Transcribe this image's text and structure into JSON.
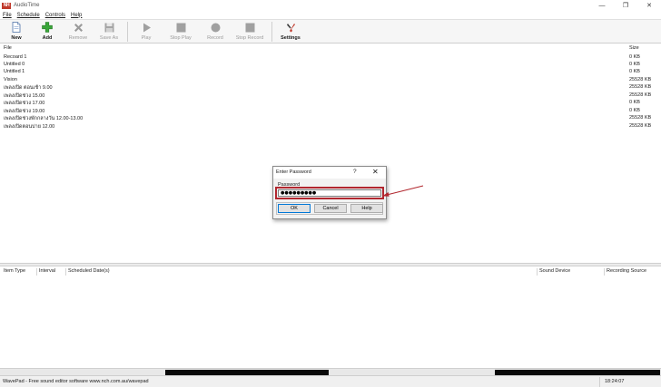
{
  "window": {
    "logo_text": "NH",
    "title": "AudioTime",
    "controls": [
      "—",
      "❐",
      "✕"
    ]
  },
  "menu": [
    "File",
    "Schedule",
    "Controls",
    "Help"
  ],
  "toolbar": {
    "buttons": [
      {
        "label": "New",
        "icon": "new-file-icon",
        "enabled": true
      },
      {
        "label": "Add",
        "icon": "add-plus-icon",
        "enabled": true
      },
      {
        "label": "Remove",
        "icon": "remove-x-icon",
        "enabled": false
      },
      {
        "label": "Save As",
        "icon": "save-disk-icon",
        "enabled": false
      },
      {
        "label": "Play",
        "icon": "play-icon",
        "enabled": false
      },
      {
        "label": "Stop Play",
        "icon": "stop-icon",
        "enabled": false
      },
      {
        "label": "Record",
        "icon": "record-icon",
        "enabled": false
      },
      {
        "label": "Stop Record",
        "icon": "stop-record-icon",
        "enabled": false
      },
      {
        "label": "Settings",
        "icon": "settings-tools-icon",
        "enabled": true
      }
    ]
  },
  "file_list": {
    "columns": {
      "file": "File",
      "size": "Size"
    },
    "rows": [
      {
        "name": "Recoard 1",
        "size": "0 KB"
      },
      {
        "name": "Untitled 0",
        "size": "0 KB"
      },
      {
        "name": "Untitled 1",
        "size": "0 KB"
      },
      {
        "name": "Vision",
        "size": "25528 KB"
      },
      {
        "name": "เพลงเปิด ตอนเช้า 9.00",
        "size": "25528 KB"
      },
      {
        "name": "เพลงเปิดช่วง 15.00",
        "size": "25528 KB"
      },
      {
        "name": "เพลงเปิดช่วง 17.00",
        "size": "0 KB"
      },
      {
        "name": "เพลงเปิดช่วง 19.00",
        "size": "0 KB"
      },
      {
        "name": "เพลงเปิดช่วงพักกลางวัน 12.00-13.00",
        "size": "25528 KB"
      },
      {
        "name": "เพลงเปิดตอนบ่าย 12.00",
        "size": "25528 KB"
      }
    ]
  },
  "schedule": {
    "columns": [
      "Item Type",
      "Interval",
      "Scheduled Date(s)",
      "Sound Device",
      "Recording Source"
    ]
  },
  "status": {
    "text": "WavePad - Free sound editor software www.nch.com.au/wavepad",
    "time": "18:24:07"
  },
  "dialog": {
    "title": "Enter Password",
    "help_glyph": "?",
    "close_glyph": "✕",
    "field_label": "Password",
    "password_value": "●●●●●●●●●",
    "buttons": {
      "ok": "OK",
      "cancel": "Cancel",
      "help": "Help"
    }
  },
  "colors": {
    "highlight": "#b2272f",
    "add_green": "#3aa63a",
    "remove_gray": "#9a9a9a"
  }
}
